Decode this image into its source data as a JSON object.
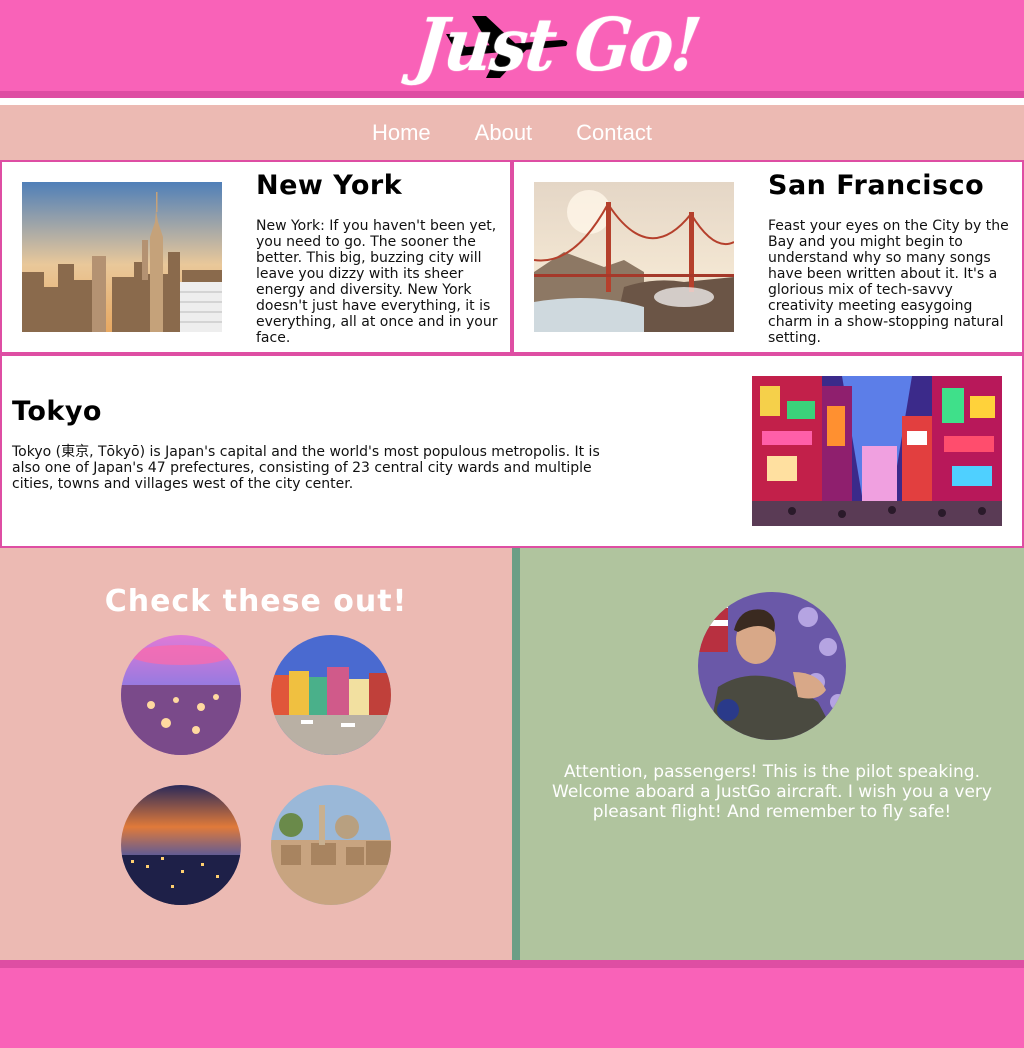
{
  "brand": {
    "logo_text": "Just Go!"
  },
  "nav": {
    "items": [
      "Home",
      "About",
      "Contact"
    ]
  },
  "destinations": [
    {
      "title": "New York",
      "text": "New York: If you haven't been yet, you need to go. The sooner the better. This big, buzzing city will leave you dizzy with its sheer energy and diversity. New York doesn't just have everything, it is everything, all at once and in your face."
    },
    {
      "title": "San Francisco",
      "text": "Feast your eyes on the City by the Bay and you might begin to understand why so many songs have been written about it. It's a glorious mix of tech-savvy creativity meeting easygoing charm in a show-stopping natural setting."
    },
    {
      "title": "Tokyo",
      "text": "Tokyo (東京, Tōkyō) is Japan's capital and the world's most populous metropolis. It is also one of Japan's 47 prefectures, consisting of 23 central city wards and multiple cities, towns and villages west of the city center."
    }
  ],
  "gallery": {
    "heading": "Check these out!"
  },
  "pilot": {
    "message": "Attention, passengers! This is the pilot speaking. Welcome aboard a JustGo aircraft. I wish you a very pleasant flight! And remember to fly safe!"
  },
  "colors": {
    "pink": "#f962b8",
    "pink_dark": "#de4ea3",
    "blush": "#ecbab3",
    "sage": "#b0c49e",
    "teal": "#6b9e86"
  }
}
